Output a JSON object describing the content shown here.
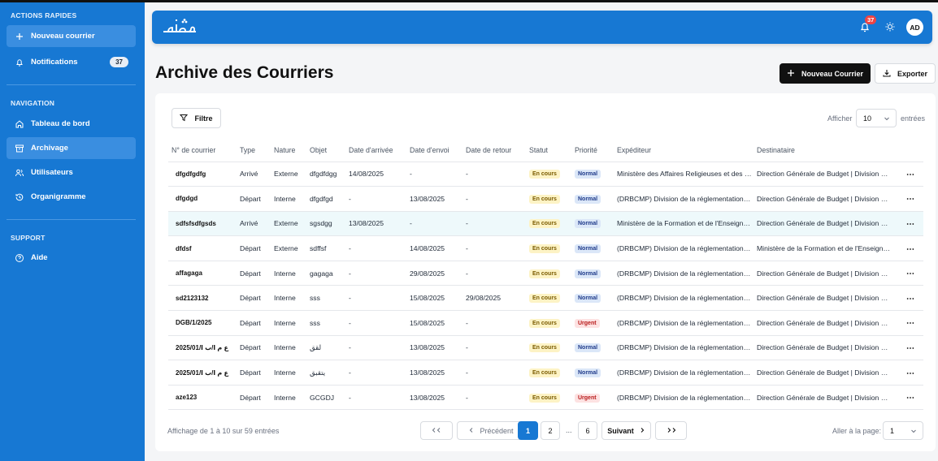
{
  "sidebar": {
    "quick_title": "ACTIONS RAPIDES",
    "new_mail": "Nouveau courrier",
    "notifications": "Notifications",
    "notifications_count": "37",
    "nav_title": "NAVIGATION",
    "nav": [
      "Tableau de bord",
      "Archivage",
      "Utilisateurs",
      "Organigramme"
    ],
    "support_title": "SUPPORT",
    "help": "Aide"
  },
  "header": {
    "logo_text": "أرشيف",
    "bell_count": "37",
    "avatar": "AD"
  },
  "page": {
    "title": "Archive des Courriers",
    "new_button": "Nouveau Courrier",
    "export_button": "Exporter",
    "filter_button": "Filtre",
    "show_label": "Afficher",
    "show_value": "10",
    "entries_label": "entrées"
  },
  "table": {
    "columns": [
      "N° de courrier",
      "Type",
      "Nature",
      "Objet",
      "Date d'arrivée",
      "Date d'envoi",
      "Date de retour",
      "Statut",
      "Priorité",
      "Expéditeur",
      "Destinataire"
    ],
    "rows": [
      {
        "num": "dfgdfgdfg",
        "type": "Arrivé",
        "nature": "Externe",
        "objet": "dfgdfdgg",
        "arrivee": "14/08/2025",
        "envoi": "-",
        "retour": "-",
        "statut": "En cours",
        "priorite": "Normal",
        "expediteur": "Ministère des Affaires Religieuses et des Wakfs",
        "destinataire": "Direction Générale de Budget | Division de la préparation"
      },
      {
        "num": "dfgdgd",
        "type": "Départ",
        "nature": "Interne",
        "objet": "dfgdfgd",
        "arrivee": "-",
        "envoi": "13/08/2025",
        "retour": "-",
        "statut": "En cours",
        "priorite": "Normal",
        "expediteur": "(DRBCMP) Division de la réglementation budgétaire",
        "destinataire": "Direction Générale de Budget | Division de la préparation"
      },
      {
        "num": "sdfsfsdfgsds",
        "type": "Arrivé",
        "nature": "Externe",
        "objet": "sgsdgg",
        "arrivee": "13/08/2025",
        "envoi": "-",
        "retour": "-",
        "statut": "En cours",
        "priorite": "Normal",
        "expediteur": "Ministère de la Formation et de l'Enseignement",
        "destinataire": "Direction Générale de Budget | Division de la préparation"
      },
      {
        "num": "dfdsf",
        "type": "Départ",
        "nature": "Externe",
        "objet": "sdffsf",
        "arrivee": "-",
        "envoi": "14/08/2025",
        "retour": "-",
        "statut": "En cours",
        "priorite": "Normal",
        "expediteur": "(DRBCMP) Division de la réglementation budgétaire",
        "destinataire": "Ministère de la Formation et de l'Enseignement"
      },
      {
        "num": "affagaga",
        "type": "Départ",
        "nature": "Interne",
        "objet": "gagaga",
        "arrivee": "-",
        "envoi": "29/08/2025",
        "retour": "-",
        "statut": "En cours",
        "priorite": "Normal",
        "expediteur": "(DRBCMP) Division de la réglementation budgétaire",
        "destinataire": "Direction Générale de Budget | Division de la préparation"
      },
      {
        "num": "sd2123132",
        "type": "Départ",
        "nature": "Interne",
        "objet": "sss",
        "arrivee": "-",
        "envoi": "15/08/2025",
        "retour": "29/08/2025",
        "statut": "En cours",
        "priorite": "Normal",
        "expediteur": "(DRBCMP) Division de la réglementation budgétaire",
        "destinataire": "Direction Générale de Budget | Division de la préparation"
      },
      {
        "num": "DGB/1/2025",
        "type": "Départ",
        "nature": "Interne",
        "objet": "sss",
        "arrivee": "-",
        "envoi": "15/08/2025",
        "retour": "-",
        "statut": "En cours",
        "priorite": "Urgent",
        "expediteur": "(DRBCMP) Division de la réglementation budgétaire",
        "destinataire": "Direction Générale de Budget | Division de la préparation"
      },
      {
        "num": "2025/ع م ا/ب ا/01",
        "type": "Départ",
        "nature": "Interne",
        "objet": "لقق",
        "arrivee": "-",
        "envoi": "13/08/2025",
        "retour": "-",
        "statut": "En cours",
        "priorite": "Normal",
        "expediteur": "(DRBCMP) Division de la réglementation budgétaire",
        "destinataire": "Direction Générale de Budget | Division de la préparation"
      },
      {
        "num": "2025/ع م ا/ب ا/01",
        "type": "Départ",
        "nature": "Interne",
        "objet": "يتقبق",
        "arrivee": "-",
        "envoi": "13/08/2025",
        "retour": "-",
        "statut": "En cours",
        "priorite": "Normal",
        "expediteur": "(DRBCMP) Division de la réglementation budgétaire",
        "destinataire": "Direction Générale de Budget | Division de la préparation"
      },
      {
        "num": "aze123",
        "type": "Départ",
        "nature": "Interne",
        "objet": "GCGDJ",
        "arrivee": "-",
        "envoi": "13/08/2025",
        "retour": "-",
        "statut": "En cours",
        "priorite": "Urgent",
        "expediteur": "(DRBCMP) Division de la réglementation budgétaire",
        "destinataire": "Direction Générale de Budget | Division de la préparation"
      }
    ]
  },
  "footer": {
    "summary": "Affichage de 1 à 10 sur 59 entrées",
    "prev": "Précédent",
    "next": "Suivant",
    "pages": [
      "1",
      "2",
      "6"
    ],
    "dots": "...",
    "goto_label": "Aller à la page:",
    "goto_value": "1"
  },
  "colors": {
    "primary": "#1778d3",
    "dark_button": "#111111",
    "status_pending": "#fdf3c5",
    "priority_normal": "#dbe7f8",
    "priority_urgent": "#fde2e2"
  }
}
